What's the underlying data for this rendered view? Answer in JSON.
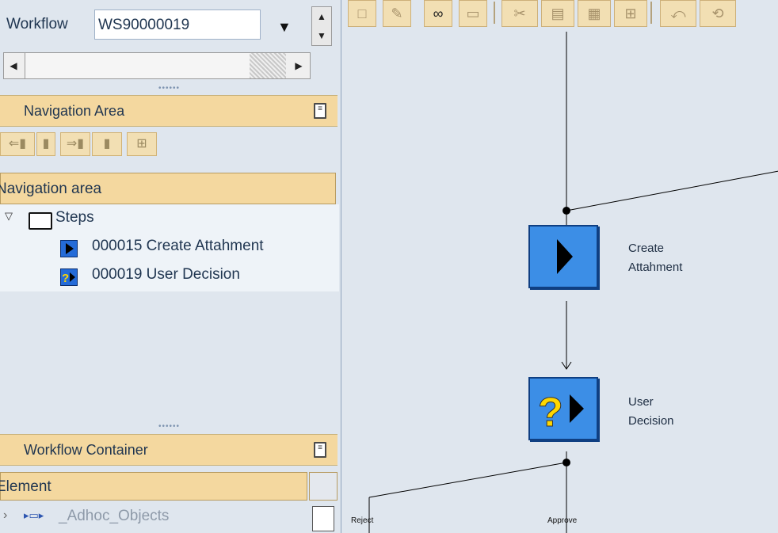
{
  "workflow": {
    "label": "Workflow",
    "value": "WS90000019",
    "dropdown_icon": "triangle-down-icon"
  },
  "navigation": {
    "header": "Navigation Area",
    "title": "Navigation area",
    "tree": {
      "root": "Steps",
      "items": [
        {
          "label": "000015 Create Attahment",
          "icon": "activity-step-icon"
        },
        {
          "label": "000019 User Decision",
          "icon": "user-decision-step-icon"
        }
      ]
    }
  },
  "container": {
    "header": "Workflow Container",
    "column": "Element",
    "rows": [
      {
        "label": "_Adhoc_Objects"
      }
    ]
  },
  "graph": {
    "nodes": [
      {
        "id": "create",
        "label_line1": "Create",
        "label_line2": "Attahment",
        "icon": "activity-step-icon"
      },
      {
        "id": "decision",
        "label_line1": "User",
        "label_line2": "Decision",
        "icon": "user-decision-step-icon"
      }
    ],
    "branches": [
      "Reject",
      "Approve"
    ]
  },
  "toolbar_icons": [
    "new-icon",
    "edit-icon",
    "glasses-icon",
    "delete-icon",
    "cut-icon",
    "copy-icon",
    "paste-icon",
    "insert-icon",
    "undo-icon",
    "redo-icon"
  ],
  "colors": {
    "header_bg": "#f4d89f",
    "panel_bg": "#dfe6ee",
    "step_blue": "#3c8ee6",
    "decision_yellow": "#ffd700"
  }
}
